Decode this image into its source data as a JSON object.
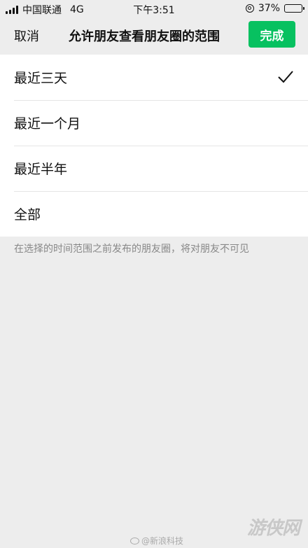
{
  "status_bar": {
    "carrier": "中国联通",
    "network": "4G",
    "time": "下午3:51",
    "battery": "37%",
    "battery_level": 0.37,
    "icons": [
      "signal-icon",
      "orientation-lock-icon",
      "battery-icon"
    ]
  },
  "nav": {
    "cancel_label": "取消",
    "title": "允许朋友查看朋友圈的范围",
    "done_label": "完成",
    "accent_color": "#07c160"
  },
  "options": [
    {
      "label": "最近三天",
      "selected": true
    },
    {
      "label": "最近一个月",
      "selected": false
    },
    {
      "label": "最近半年",
      "selected": false
    },
    {
      "label": "全部",
      "selected": false
    }
  ],
  "footnote": "在选择的时间范围之前发布的朋友圈，将对朋友不可见",
  "watermarks": {
    "center": "@新浪科技",
    "right": "游侠网"
  }
}
